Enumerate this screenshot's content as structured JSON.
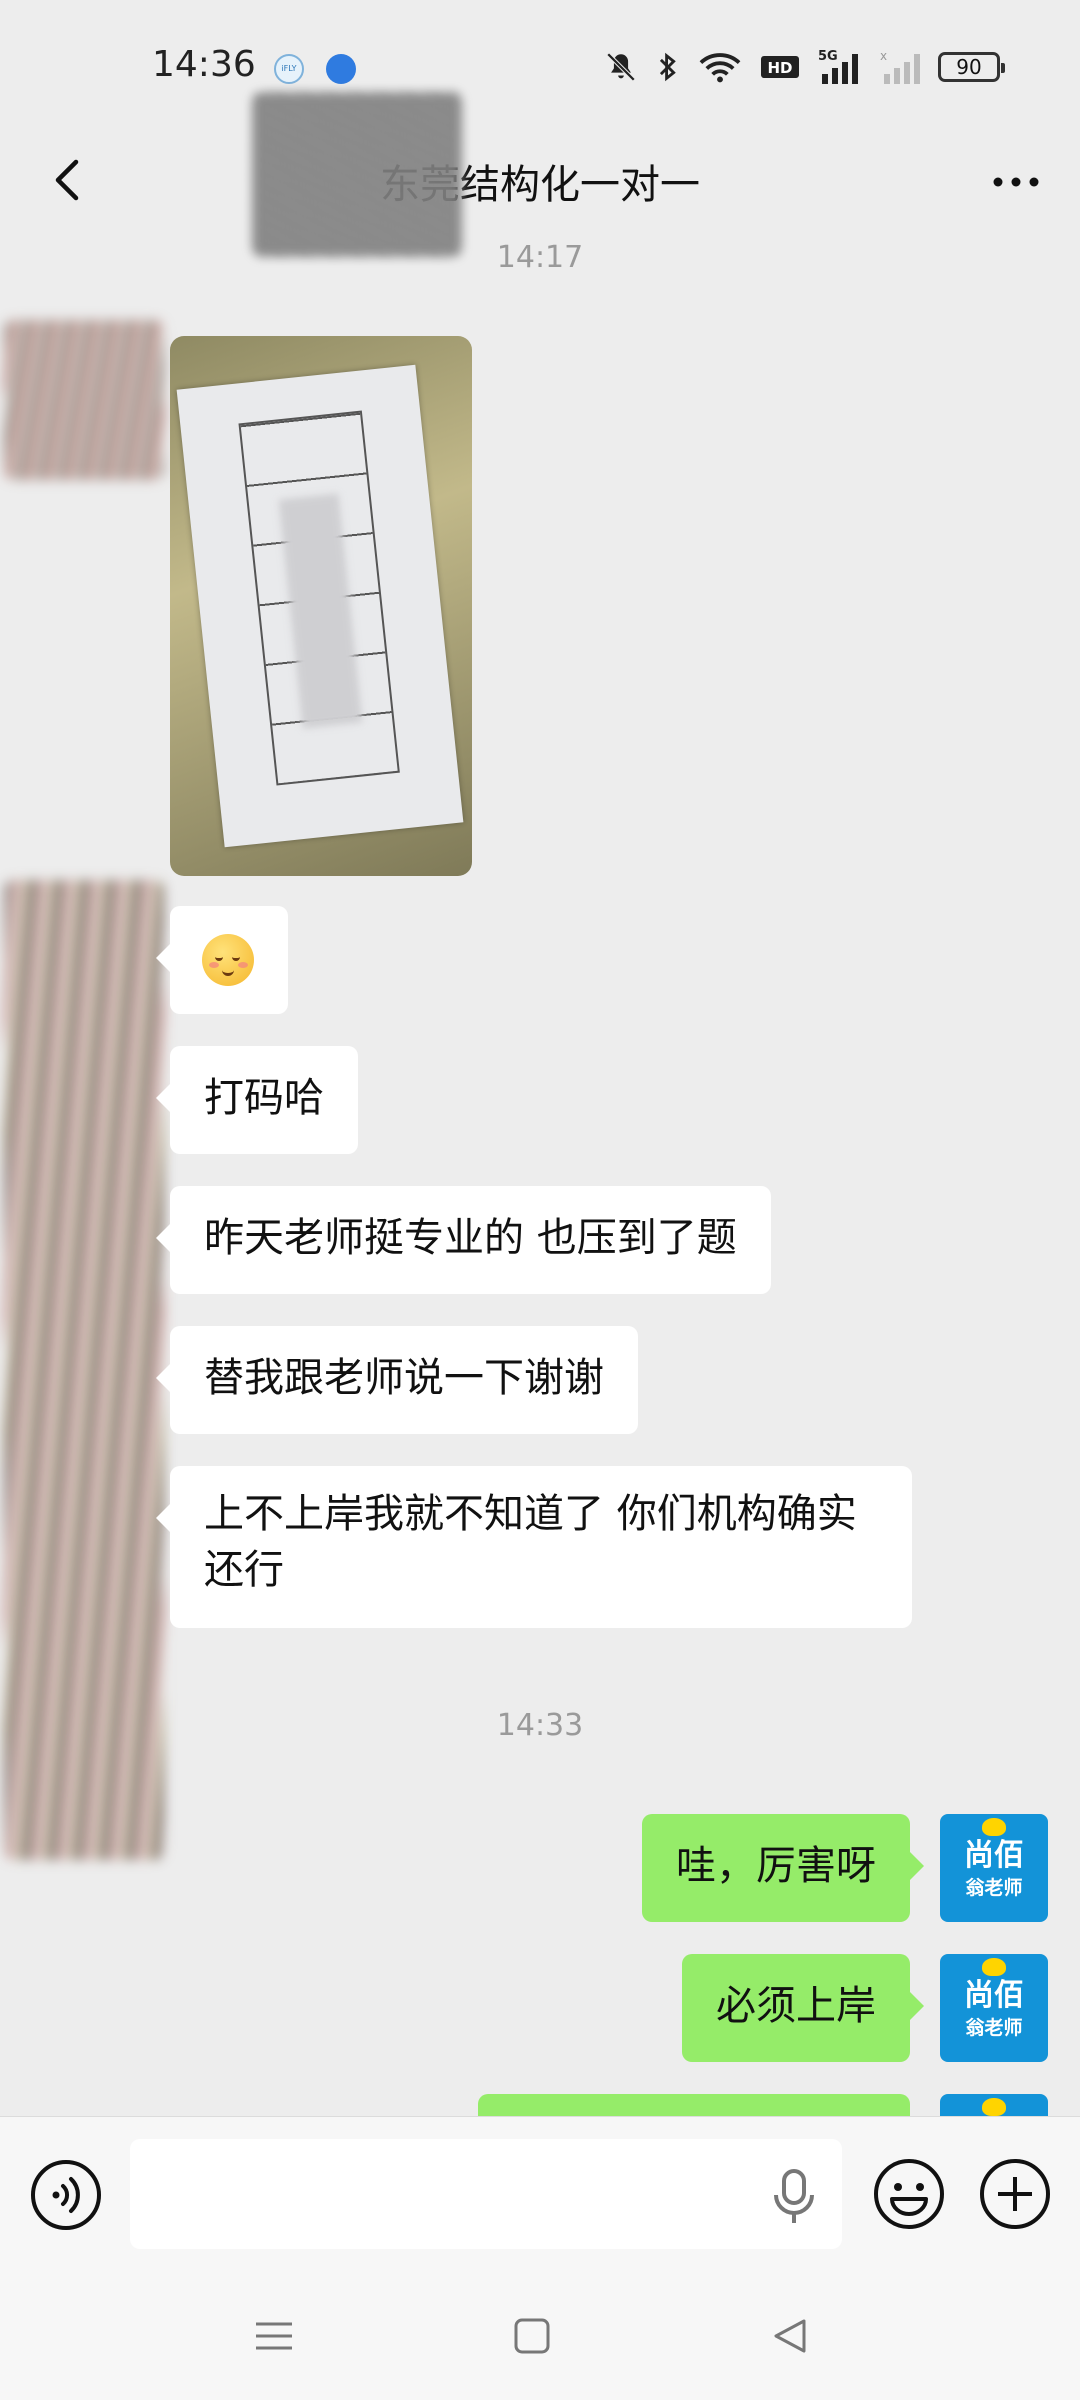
{
  "status_bar": {
    "time": "14:36",
    "app_badge_1": "iFLY",
    "battery": "90",
    "icons": [
      "mute-bell-icon",
      "bluetooth-icon",
      "wifi-icon",
      "hd-icon",
      "signal-5g-icon",
      "signal-2-icon",
      "battery-icon"
    ]
  },
  "header": {
    "title": "东莞结构化一对一",
    "back_icon": "chevron-left-icon",
    "more_icon": "more-dots-icon"
  },
  "chat": {
    "timestamps": [
      "14:17",
      "14:33"
    ],
    "incoming": [
      {
        "type": "image",
        "desc_icon": "photo-thumbnail"
      },
      {
        "type": "emoji",
        "icon": "blushing-smile-emoji"
      },
      {
        "type": "text",
        "text": "打码哈"
      },
      {
        "type": "text",
        "text": "昨天老师挺专业的 也压到了题"
      },
      {
        "type": "text",
        "text": "替我跟老师说一下谢谢"
      },
      {
        "type": "text",
        "text": "上不上岸我就不知道了 你们机构确实还行"
      }
    ],
    "outgoing": [
      {
        "text": "哇，厉害呀"
      },
      {
        "text": "必须上岸"
      },
      {
        "text": ""
      }
    ],
    "my_avatar": {
      "line1": "尚佰",
      "line2": "翁老师"
    }
  },
  "input_bar": {
    "value": "",
    "placeholder": ""
  },
  "colors": {
    "background": "#ededed",
    "incoming_bubble": "#ffffff",
    "outgoing_bubble": "#95ec69",
    "avatar_blue": "#1393d8"
  }
}
